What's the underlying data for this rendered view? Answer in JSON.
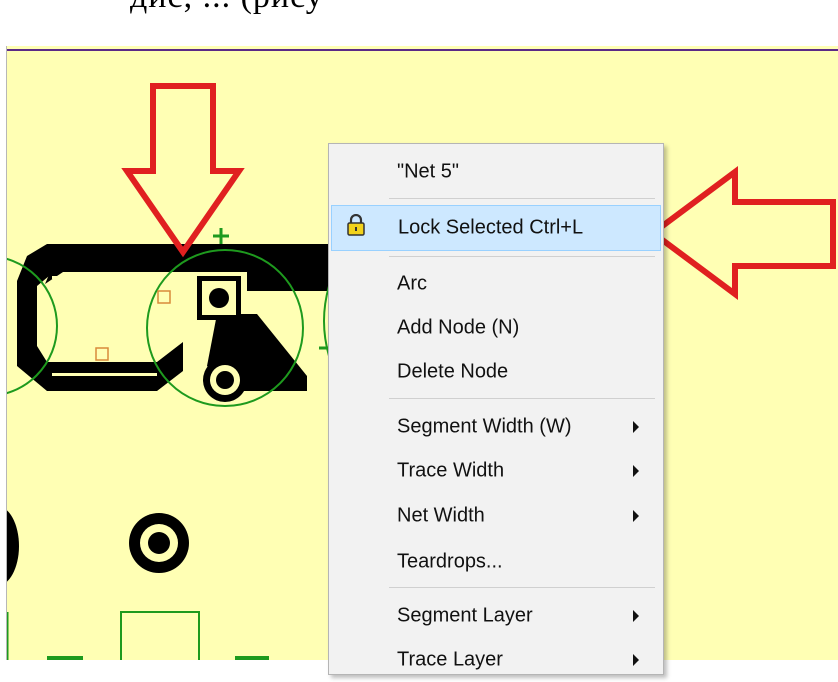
{
  "header": {
    "text": "дис, ... (рису"
  },
  "canvas": {
    "background_color": "#ffffb4",
    "trace_color": "#000000",
    "outline_color": "#1e9a1e",
    "annotation_arrow_color": "#e02020"
  },
  "context_menu": {
    "net_name": "\"Net 5\"",
    "lock_selected": "Lock Selected Ctrl+L",
    "arc": "Arc",
    "add_node": "Add Node (N)",
    "delete_node": "Delete Node",
    "segment_width": "Segment Width (W)",
    "trace_width": "Trace Width",
    "net_width": "Net Width",
    "teardrops": "Teardrops...",
    "segment_layer": "Segment Layer",
    "trace_layer": "Trace Layer",
    "highlight_color": "#cde8ff"
  }
}
